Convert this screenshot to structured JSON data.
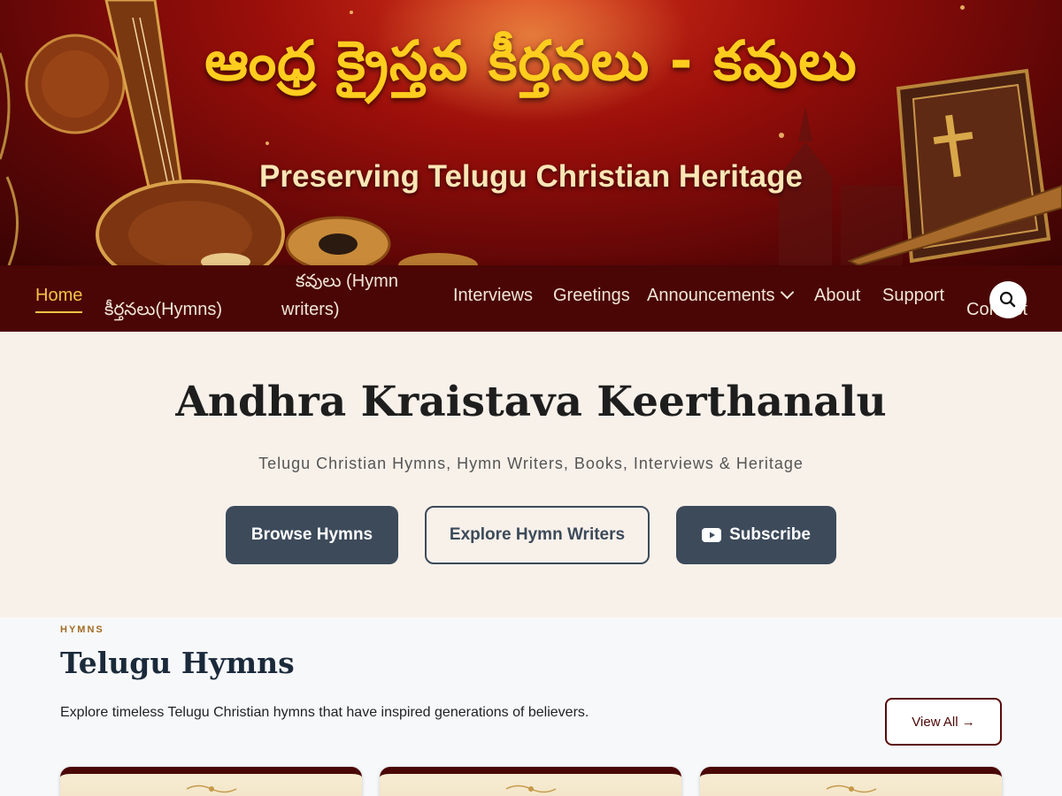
{
  "banner": {
    "title": "ఆంధ్ర క్రైస్తవ కీర్తనలు - కవులు",
    "tagline": "Preserving Telugu Christian Heritage"
  },
  "nav": {
    "items": [
      {
        "label": "Home",
        "active": true
      },
      {
        "label": "కీర్తనలు(Hymns)"
      },
      {
        "label": "కవులు (Hymn"
      },
      {
        "label": "writers)"
      },
      {
        "label": "Interviews"
      },
      {
        "label": "Greetings"
      },
      {
        "label": "Announcements"
      },
      {
        "label": "About"
      },
      {
        "label": "Support"
      },
      {
        "label": "Contact"
      }
    ]
  },
  "intro": {
    "title": "Andhra Kraistava Keerthanalu",
    "subtitle": "Telugu Christian Hymns, Hymn Writers, Books, Interviews & Heritage",
    "buttons": {
      "browse": "Browse Hymns",
      "explore": "Explore Hymn Writers",
      "subscribe": "Subscribe"
    }
  },
  "hymns_section": {
    "kicker": "HYMNS",
    "title": "Telugu Hymns",
    "description": "Explore timeless Telugu Christian hymns that have inspired generations of believers.",
    "view_all": "View All →"
  },
  "colors": {
    "title_gold": "#ffcd1e",
    "nav_bg": "#4a0505",
    "nav_active": "#f5c34a",
    "button_dark": "#3c4a5a",
    "intro_bg": "#f8f1ea"
  }
}
